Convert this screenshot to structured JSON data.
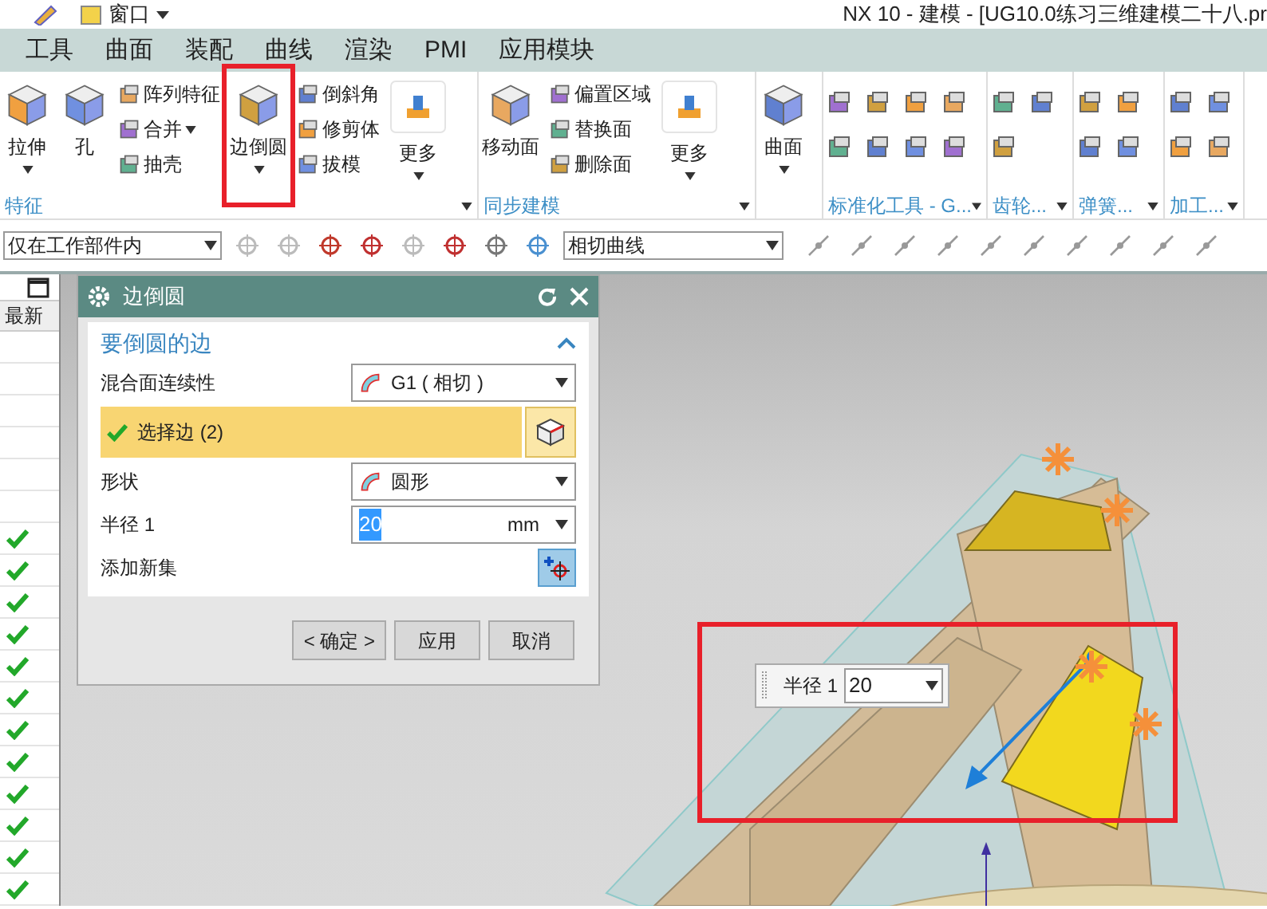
{
  "title_bar": {
    "window_menu": "窗口",
    "title": "NX 10 - 建模 - [UG10.0练习三维建模二十八.pr"
  },
  "tabs": [
    {
      "label": "工具",
      "selected": false
    },
    {
      "label": "曲面",
      "selected": false
    },
    {
      "label": "装配",
      "selected": false
    },
    {
      "label": "曲线",
      "selected": false
    },
    {
      "label": "渲染",
      "selected": false
    },
    {
      "label": "PMI",
      "selected": false
    },
    {
      "label": "应用模块",
      "selected": false
    }
  ],
  "ribbon": [
    {
      "label": "特征",
      "launcher": true,
      "items": [
        {
          "kind": "large",
          "label": "拉伸",
          "caret": true
        },
        {
          "kind": "large",
          "label": "孔",
          "caret": false
        },
        {
          "kind": "stack",
          "entries": [
            {
              "label": "阵列特征",
              "caret": false
            },
            {
              "label": "合并",
              "caret": true
            },
            {
              "label": "抽壳",
              "caret": false
            }
          ]
        },
        {
          "kind": "large",
          "label": "边倒圆",
          "caret": true
        },
        {
          "kind": "stack",
          "entries": [
            {
              "label": "倒斜角",
              "caret": false
            },
            {
              "label": "修剪体",
              "caret": false
            },
            {
              "label": "拔模",
              "caret": false
            }
          ]
        },
        {
          "kind": "more",
          "label": "更多",
          "caret": true
        }
      ]
    },
    {
      "label": "同步建模",
      "launcher": true,
      "items": [
        {
          "kind": "large",
          "label": "移动面",
          "caret": false
        },
        {
          "kind": "stack",
          "entries": [
            {
              "label": "偏置区域",
              "caret": false
            },
            {
              "label": "替换面",
              "caret": false
            },
            {
              "label": "删除面",
              "caret": false
            }
          ]
        },
        {
          "kind": "more",
          "label": "更多",
          "caret": true
        }
      ]
    },
    {
      "launcher": false,
      "items": [
        {
          "kind": "large",
          "label": "曲面",
          "caret": true
        }
      ]
    },
    {
      "label": "标准化工具 - G...",
      "launcher": true,
      "items": [
        {
          "kind": "icons"
        }
      ]
    },
    {
      "label": "齿轮...",
      "launcher": true,
      "items": [
        {
          "kind": "icons"
        }
      ]
    },
    {
      "label": "弹簧...",
      "launcher": true,
      "items": [
        {
          "kind": "icons"
        }
      ]
    },
    {
      "label": "加工...",
      "launcher": true,
      "items": [
        {
          "kind": "icons"
        }
      ]
    }
  ],
  "toolbar": {
    "filter": "仅在工作部件内",
    "curve_rule": "相切曲线"
  },
  "part_navigator": {
    "column": "最新",
    "rows": [
      {
        "checked": false
      },
      {
        "checked": false
      },
      {
        "checked": false
      },
      {
        "checked": false
      },
      {
        "checked": false
      },
      {
        "checked": false
      },
      {
        "checked": true
      },
      {
        "checked": true
      },
      {
        "checked": true
      },
      {
        "checked": true
      },
      {
        "checked": true
      },
      {
        "checked": true
      },
      {
        "checked": true
      },
      {
        "checked": true
      },
      {
        "checked": true
      },
      {
        "checked": true
      },
      {
        "checked": true
      },
      {
        "checked": true
      }
    ]
  },
  "dialog": {
    "title": "边倒圆",
    "section": {
      "title": "要倒圆的边",
      "expanded": true,
      "rows": [
        {
          "kind": "dropdown",
          "label": "混合面连续性",
          "value": "G1 ( 相切 )"
        },
        {
          "kind": "selection",
          "label": "选择边 (2)",
          "done": true
        },
        {
          "kind": "dropdown",
          "label": "形状",
          "value": "圆形"
        },
        {
          "kind": "number",
          "label": "半径 1",
          "value": "20",
          "unit": "mm"
        },
        {
          "kind": "action",
          "label": "添加新集"
        }
      ]
    },
    "buttons": [
      "< 确定 >",
      "应用",
      "取消"
    ]
  },
  "radius_popup": {
    "label": "半径 1",
    "value": "20"
  }
}
